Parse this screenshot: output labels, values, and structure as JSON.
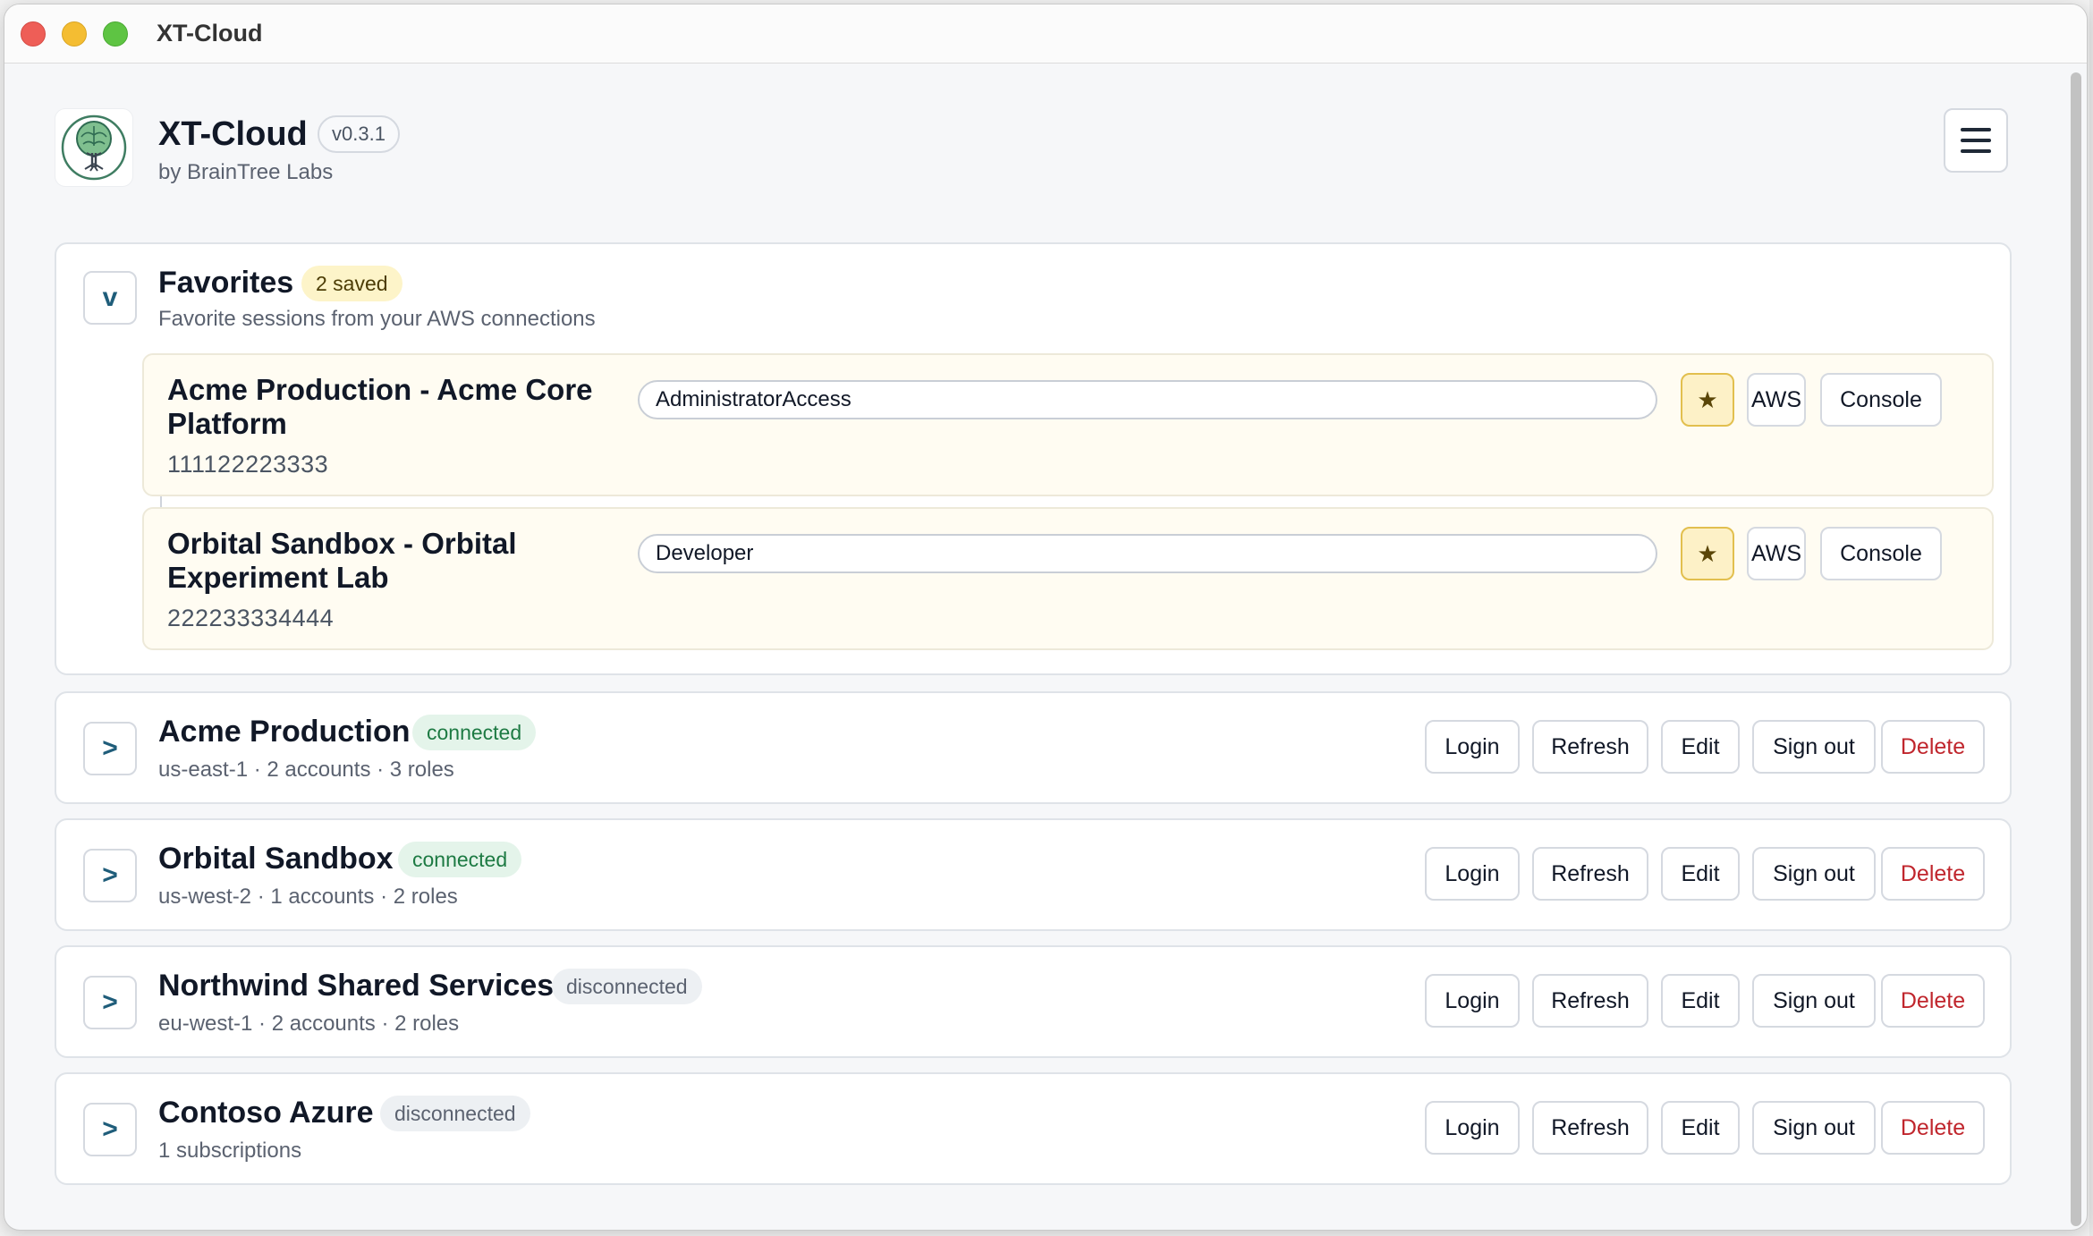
{
  "window": {
    "title": "XT-Cloud"
  },
  "app": {
    "name": "XT-Cloud",
    "version": "v0.3.1",
    "byline": "by BrainTree Labs"
  },
  "favorites": {
    "toggle": "v",
    "title": "Favorites",
    "badge": "2 saved",
    "subtitle": "Favorite sessions from your AWS connections",
    "items": [
      {
        "name": "Acme Production - Acme Core Platform",
        "account_id": "111122223333",
        "role": "AdministratorAccess",
        "star": "★",
        "aws_label": "AWS",
        "console_label": "Console"
      },
      {
        "name": "Orbital Sandbox - Orbital Experiment Lab",
        "account_id": "222233334444",
        "role": "Developer",
        "star": "★",
        "aws_label": "AWS",
        "console_label": "Console"
      }
    ]
  },
  "connections": [
    {
      "toggle": ">",
      "name": "Acme Production",
      "status": "connected",
      "details": "us-east-1 · 2 accounts · 3 roles"
    },
    {
      "toggle": ">",
      "name": "Orbital Sandbox",
      "status": "connected",
      "details": "us-west-2 · 1 accounts · 2 roles"
    },
    {
      "toggle": ">",
      "name": "Northwind Shared Services",
      "status": "disconnected",
      "details": "eu-west-1 · 2 accounts · 2 roles"
    },
    {
      "toggle": ">",
      "name": "Contoso Azure",
      "status": "disconnected",
      "details": "1 subscriptions"
    }
  ],
  "actions": {
    "login": "Login",
    "refresh": "Refresh",
    "edit": "Edit",
    "sign_out": "Sign out",
    "delete": "Delete"
  },
  "colors": {
    "accent": "#1f5d7a",
    "connected": "#1d7a43",
    "danger": "#c0262d",
    "favorite_bg": "#fffcf2",
    "star_bg": "#fdf1c7"
  },
  "icons": {
    "menu": "hamburger-icon",
    "logo": "tree-brain-logo",
    "favorite": "star-icon"
  }
}
